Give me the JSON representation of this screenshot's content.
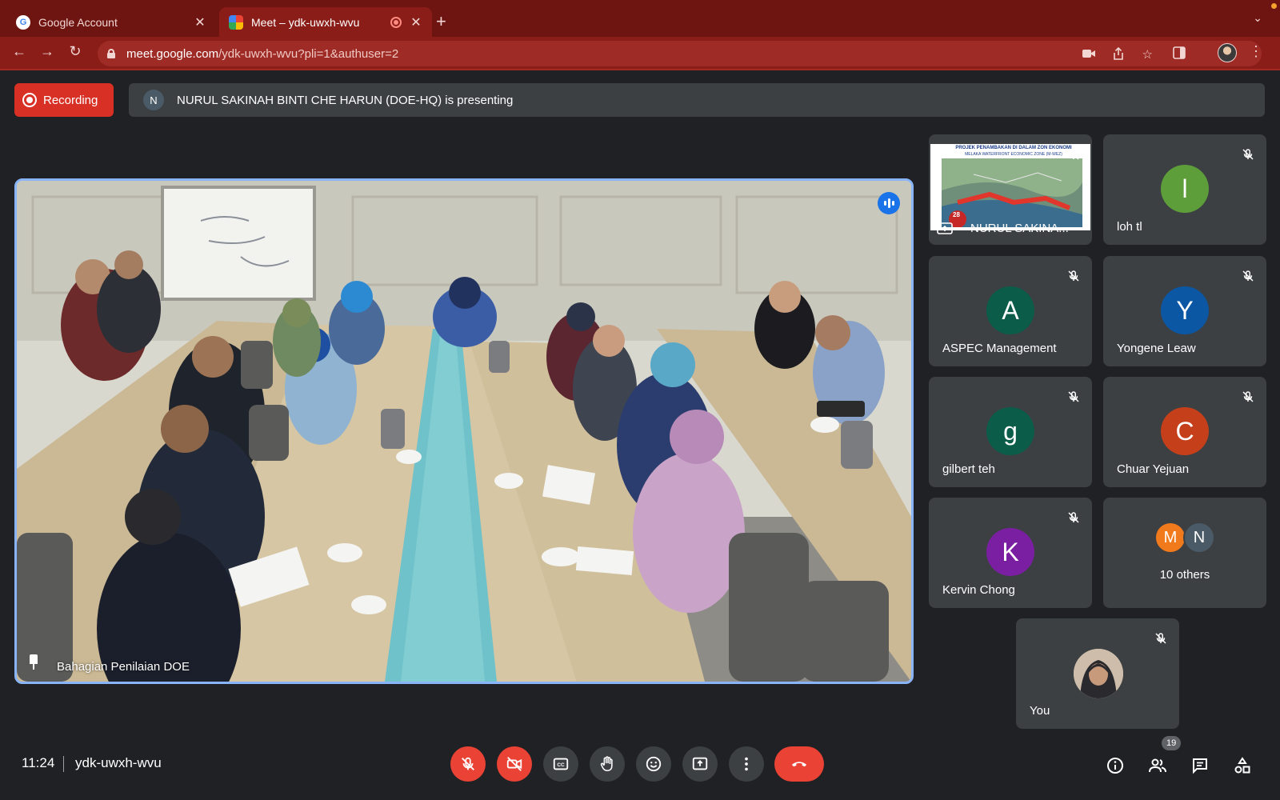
{
  "browser": {
    "tabs": [
      {
        "title": "Google Account",
        "favicon": "google-icon",
        "active": false
      },
      {
        "title": "Meet – ydk-uwxh-wvu",
        "favicon": "meet-icon",
        "active": true,
        "recording": true
      }
    ],
    "new_tab_label": "+",
    "url_host": "meet.google.com",
    "url_path": "/ydk-uwxh-wvu?pli=1&authuser=2",
    "accent_color": "#8a1d18"
  },
  "meet": {
    "recording_label": "Recording",
    "presenter_initial": "N",
    "presenting_text": "NURUL SAKINAH BINTI CHE HARUN (DOE-HQ) is presenting",
    "main_video": {
      "name": "Bahagian Penilaian DOE",
      "pinned": true,
      "speaking": true
    },
    "tiles": [
      {
        "name": "NURUL SAKINA...",
        "type": "screen-share",
        "muted": true,
        "slide_title": "PROJEK PENAMBAKAN DI DALAM ZON EKONOMI",
        "slide_subtitle": "MELAKA WATERFRONT ECONOMIC ZONE (M-WEZ)",
        "slide_badge": "28"
      },
      {
        "name": "loh tl",
        "initial": "l",
        "color": "#5e9e3a",
        "muted": true
      },
      {
        "name": "ASPEC Management",
        "initial": "A",
        "color": "#0b5d4a",
        "muted": true
      },
      {
        "name": "Yongene Leaw",
        "initial": "Y",
        "color": "#0b57a4",
        "muted": true
      },
      {
        "name": "gilbert teh",
        "initial": "g",
        "color": "#0b5d4a",
        "muted": true
      },
      {
        "name": "Chuar Yejuan",
        "initial": "C",
        "color": "#c5401a",
        "muted": true
      },
      {
        "name": "Kervin Chong",
        "initial": "K",
        "color": "#7b1fa2",
        "muted": true
      },
      {
        "name": "10 others",
        "type": "others",
        "avatars": [
          {
            "initial": "M",
            "color": "#f17a1d"
          },
          {
            "initial": "N",
            "color": "#4a5a66"
          }
        ]
      },
      {
        "name": "You",
        "type": "self",
        "muted": true
      }
    ],
    "bottom_bar": {
      "time": "11:24",
      "meeting_code": "ydk-uwxh-wvu",
      "controls": [
        "mic-off-icon",
        "camera-off-icon",
        "captions-icon",
        "raise-hand-icon",
        "emoji-icon",
        "present-icon",
        "more-options-icon",
        "end-call-icon"
      ],
      "right_controls": [
        "info-icon",
        "people-icon",
        "chat-icon",
        "activities-icon"
      ],
      "people_count": "19"
    }
  }
}
